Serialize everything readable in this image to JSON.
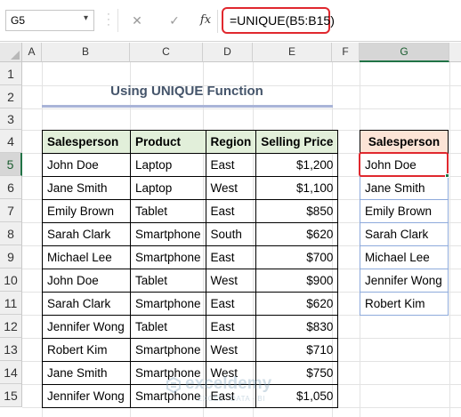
{
  "formula_bar": {
    "name_box": "G5",
    "cancel_icon": "✕",
    "enter_icon": "✓",
    "fx_label": "fx",
    "formula": "=UNIQUE(B5:B15)"
  },
  "columns": [
    "A",
    "B",
    "C",
    "D",
    "E",
    "F",
    "G"
  ],
  "rows": [
    "1",
    "2",
    "3",
    "4",
    "5",
    "6",
    "7",
    "8",
    "9",
    "10",
    "11",
    "12",
    "13",
    "14",
    "15"
  ],
  "selected": {
    "column": "G",
    "row": "5"
  },
  "title": "Using UNIQUE Function",
  "main_table": {
    "headers": [
      "Salesperson",
      "Product",
      "Region",
      "Selling Price"
    ],
    "rows": [
      [
        "John Doe",
        "Laptop",
        "East",
        "$1,200"
      ],
      [
        "Jane Smith",
        "Laptop",
        "West",
        "$1,100"
      ],
      [
        "Emily Brown",
        "Tablet",
        "East",
        "$850"
      ],
      [
        "Sarah Clark",
        "Smartphone",
        "South",
        "$620"
      ],
      [
        "Michael Lee",
        "Smartphone",
        "East",
        "$700"
      ],
      [
        "John Doe",
        "Tablet",
        "West",
        "$900"
      ],
      [
        "Sarah Clark",
        "Smartphone",
        "East",
        "$620"
      ],
      [
        "Jennifer Wong",
        "Tablet",
        "East",
        "$830"
      ],
      [
        "Robert Kim",
        "Smartphone",
        "West",
        "$710"
      ],
      [
        "Jane Smith",
        "Smartphone",
        "West",
        "$750"
      ],
      [
        "Jennifer Wong",
        "Smartphone",
        "East",
        "$1,050"
      ]
    ]
  },
  "unique_table": {
    "header": "Salesperson",
    "values": [
      "John Doe",
      "Jane Smith",
      "Emily Brown",
      "Sarah Clark",
      "Michael Lee",
      "Jennifer Wong",
      "Robert Kim"
    ]
  },
  "watermark": {
    "name": "exceldemy",
    "tagline": "EXCEL · DATA · BI"
  },
  "colors": {
    "accent": "#217346",
    "highlight": "#e0282e",
    "header_green": "#e2efda",
    "header_peach": "#fce4d6",
    "title": "#44546a"
  }
}
